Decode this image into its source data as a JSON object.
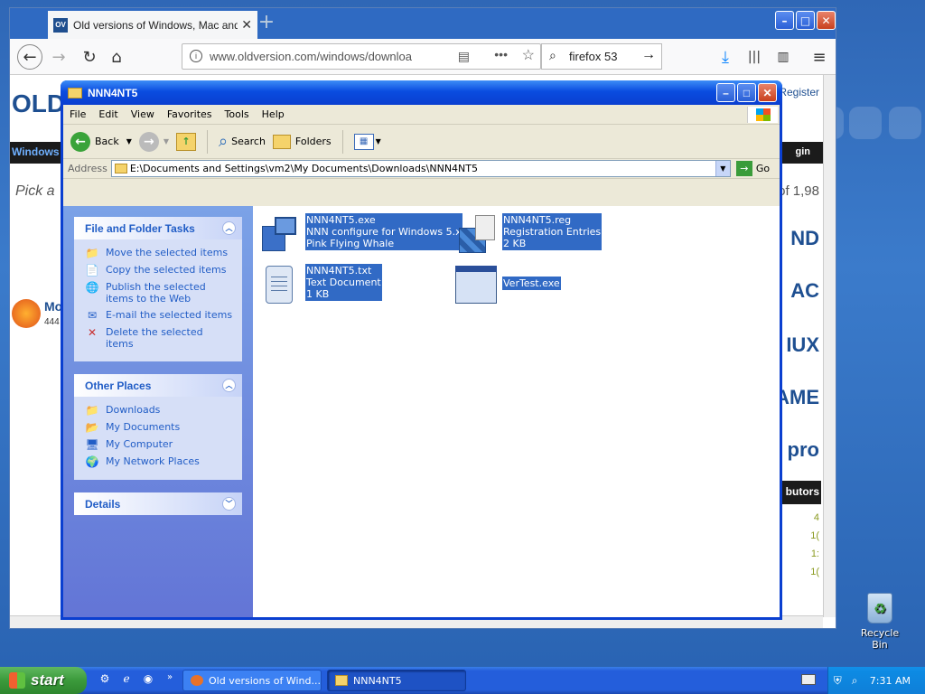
{
  "firefox": {
    "tab_title": "Old versions of Windows, Mac and",
    "tab_favicon": "OV",
    "url": "www.oldversion.com/windows/downloa",
    "search_query": "firefox 53",
    "page": {
      "logo": "OLD",
      "register": "Register",
      "pick_text": "Pick a",
      "count_text": "of 1,98",
      "windows_link": "Windows",
      "login": "gin",
      "product_name": "Mo",
      "product_sub": "444",
      "contributors": "butors",
      "right_nav": [
        "ND",
        "AC",
        "IUX",
        "AME",
        "pro"
      ],
      "right_numbers": [
        "4",
        "1(",
        "1:",
        "1("
      ]
    }
  },
  "explorer": {
    "title": "NNN4NT5",
    "menu": [
      "File",
      "Edit",
      "View",
      "Favorites",
      "Tools",
      "Help"
    ],
    "toolbar": {
      "back": "Back",
      "search": "Search",
      "folders": "Folders"
    },
    "address_label": "Address",
    "address": "E:\\Documents and Settings\\vm2\\My Documents\\Downloads\\NNN4NT5",
    "go": "Go",
    "file_tasks": {
      "title": "File and Folder Tasks",
      "items": [
        {
          "label": "Move the selected items",
          "icon": "move-icon"
        },
        {
          "label": "Copy the selected items",
          "icon": "copy-icon"
        },
        {
          "label": "Publish the selected items to the Web",
          "icon": "publish-web-icon"
        },
        {
          "label": "E-mail the selected items",
          "icon": "email-icon"
        },
        {
          "label": "Delete the selected items",
          "icon": "delete-icon"
        }
      ]
    },
    "other_places": {
      "title": "Other Places",
      "items": [
        {
          "label": "Downloads",
          "icon": "folder-icon"
        },
        {
          "label": "My Documents",
          "icon": "my-documents-icon"
        },
        {
          "label": "My Computer",
          "icon": "my-computer-icon"
        },
        {
          "label": "My Network Places",
          "icon": "network-places-icon"
        }
      ]
    },
    "details": {
      "title": "Details"
    },
    "files": [
      {
        "name": "NNN4NT5.exe",
        "line2": "NNN configure for Windows 5.x",
        "line3": "Pink Flying Whale",
        "icon": "exe-setup-icon"
      },
      {
        "name": "NNN4NT5.reg",
        "line2": "Registration Entries",
        "line3": "2 KB",
        "icon": "registry-icon"
      },
      {
        "name": "NNN4NT5.txt",
        "line2": "Text Document",
        "line3": "1 KB",
        "icon": "text-document-icon"
      },
      {
        "name": "VerTest.exe",
        "line2": "",
        "line3": "",
        "icon": "window-app-icon"
      }
    ]
  },
  "desktop": {
    "recycle_bin": "Recycle Bin"
  },
  "taskbar": {
    "start": "start",
    "items": [
      {
        "label": "Old versions of Wind...",
        "active": false
      },
      {
        "label": "NNN4NT5",
        "active": true
      }
    ],
    "clock": "7:31 AM"
  },
  "colors": {
    "xp_blue": "#0a3fd0",
    "selection": "#316ac5",
    "taskpane_link": "#215dc6"
  }
}
